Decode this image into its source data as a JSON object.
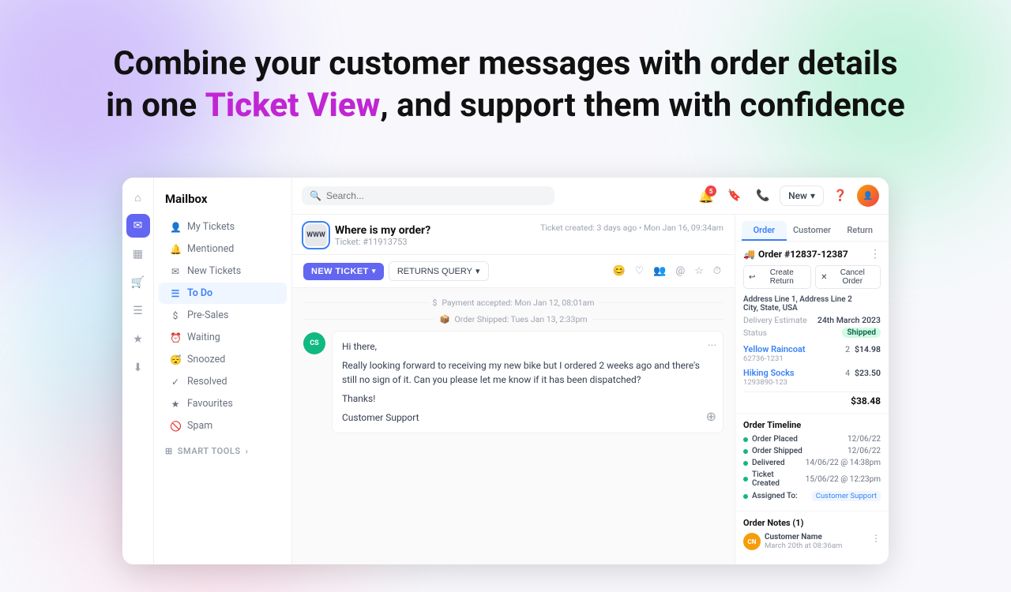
{
  "headline": {
    "line1": "Combine your customer messages with order details",
    "line2_plain_start": "in one ",
    "line2_highlight": "Ticket View",
    "line2_plain_end": ", and support them with confidence"
  },
  "sidebar": {
    "title": "Mailbox",
    "icons": [
      {
        "name": "home-icon",
        "symbol": "⌂",
        "active": false
      },
      {
        "name": "mail-icon",
        "symbol": "✉",
        "active": true
      },
      {
        "name": "chart-icon",
        "symbol": "▦",
        "active": false
      },
      {
        "name": "cart-icon",
        "symbol": "🛒",
        "active": false
      },
      {
        "name": "doc-icon",
        "symbol": "☰",
        "active": false
      },
      {
        "name": "star-icon",
        "symbol": "★",
        "active": false
      },
      {
        "name": "download-icon",
        "symbol": "⬇",
        "active": false
      }
    ],
    "nav_items": [
      {
        "label": "My Tickets",
        "icon": "👤",
        "active": false
      },
      {
        "label": "Mentioned",
        "icon": "🔔",
        "active": false
      },
      {
        "label": "New Tickets",
        "icon": "✉",
        "active": false
      },
      {
        "label": "To Do",
        "icon": "☰",
        "active": true
      },
      {
        "label": "Pre-Sales",
        "icon": "$",
        "active": false
      },
      {
        "label": "Waiting",
        "icon": "⏰",
        "active": false
      },
      {
        "label": "Snoozed",
        "icon": "😴",
        "active": false
      },
      {
        "label": "Resolved",
        "icon": "✓",
        "active": false
      },
      {
        "label": "Favourites",
        "icon": "★",
        "active": false
      },
      {
        "label": "Spam",
        "icon": "🚫",
        "active": false
      }
    ],
    "smart_tools_label": "SMART TOOLS"
  },
  "topbar": {
    "search_placeholder": "Search...",
    "notification_count": "5",
    "new_button_label": "New"
  },
  "ticket": {
    "sender_initials": "WWW",
    "subject": "Where is my order?",
    "ticket_id": "Ticket: #11913753",
    "created": "Ticket created: 3 days ago",
    "date": "Mon Jan 16, 09:34am",
    "new_ticket_label": "NEW TICKET",
    "returns_query_label": "RETURNS QUERY",
    "events": [
      {
        "icon": "$",
        "text": "Payment accepted: Mon Jan 12, 08:01am"
      },
      {
        "icon": "📦",
        "text": "Order Shipped: Tues Jan 13, 2:33pm"
      }
    ],
    "message": {
      "sender_initials": "CS",
      "greeting": "Hi there,",
      "body1": "Really looking forward to receiving my new bike but I ordered 2 weeks ago and there's still no sign of it. Can you please let me know if it has been dispatched?",
      "body2": "Thanks!",
      "signature": "Customer Support"
    }
  },
  "order_panel": {
    "tabs": [
      {
        "label": "Order",
        "active": true
      },
      {
        "label": "Customer",
        "active": false
      },
      {
        "label": "Return",
        "active": false
      }
    ],
    "order_number": "Order #12837-12387",
    "actions": [
      {
        "label": "Create Return",
        "icon": "↩"
      },
      {
        "label": "Cancel Order",
        "icon": "✕"
      }
    ],
    "address_line1": "Address Line 1, Address Line 2",
    "address_line2": "City, State, USA",
    "delivery_estimate_label": "Delivery Estimate",
    "delivery_estimate_val": "24th March 2023",
    "status_label": "Status",
    "status_val": "Shipped",
    "products": [
      {
        "name": "Yellow Raincoat",
        "sku": "62736-1231",
        "qty": 2,
        "price": "$14.98"
      },
      {
        "name": "Hiking Socks",
        "sku": "1293890-123",
        "qty": 4,
        "price": "$23.50"
      }
    ],
    "total": "$38.48",
    "timeline": {
      "title": "Order Timeline",
      "items": [
        {
          "label": "Order Placed",
          "date": "12/06/22",
          "color": "#10b981"
        },
        {
          "label": "Order Shipped",
          "date": "12/06/22",
          "color": "#10b981"
        },
        {
          "label": "Delivered",
          "date": "14/06/22 @ 14:38pm",
          "color": "#10b981"
        },
        {
          "label": "Ticket Created",
          "date": "15/06/22 @ 12:23pm",
          "color": "#10b981"
        },
        {
          "label": "Assigned To:",
          "date": "Customer Support",
          "color": "#10b981",
          "is_assigned": true
        }
      ]
    },
    "notes": {
      "title": "Order Notes (1)",
      "items": [
        {
          "initials": "CN",
          "name": "Customer Name",
          "date": "March 20th at 08:36am"
        }
      ]
    }
  }
}
